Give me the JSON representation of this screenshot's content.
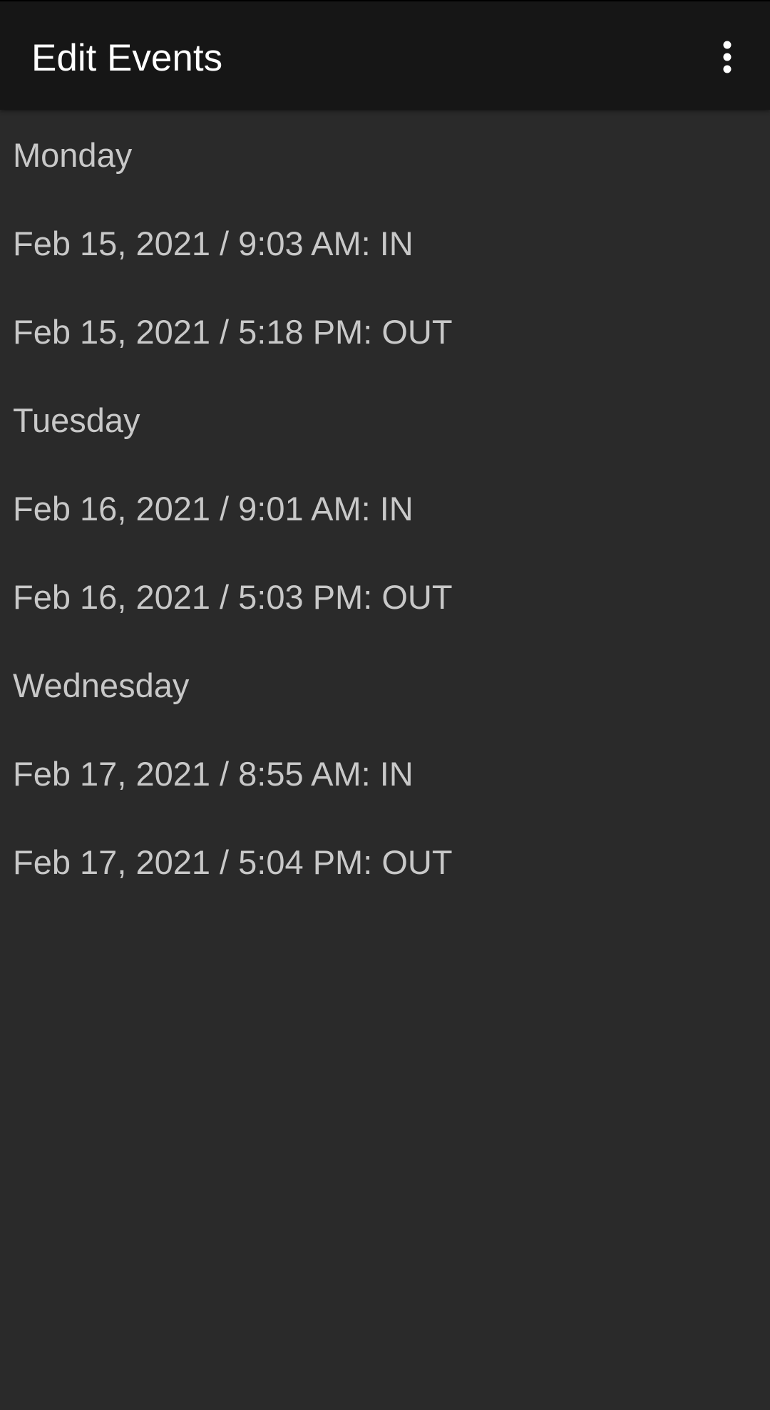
{
  "app_bar": {
    "title": "Edit Events",
    "menu_icon": "more-vert-icon"
  },
  "days": [
    {
      "label": "Monday",
      "events": [
        "Feb 15, 2021 / 9:03 AM: IN",
        "Feb 15, 2021 / 5:18 PM: OUT"
      ]
    },
    {
      "label": "Tuesday",
      "events": [
        "Feb 16, 2021 / 9:01 AM: IN",
        "Feb 16, 2021 / 5:03 PM: OUT"
      ]
    },
    {
      "label": "Wednesday",
      "events": [
        "Feb 17, 2021 / 8:55 AM: IN",
        "Feb 17, 2021 / 5:04 PM: OUT"
      ]
    }
  ],
  "colors": {
    "background": "#2a2a2a",
    "app_bar": "#161616",
    "title_text": "#ffffff",
    "list_text": "#c8c8c8"
  }
}
